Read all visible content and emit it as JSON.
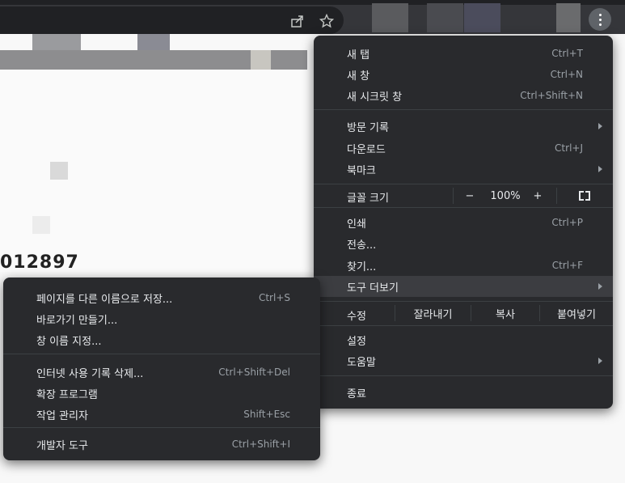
{
  "colors": {
    "menu_bg": "#292a2d",
    "highlight": "#3c3d41",
    "text": "#e8eaed",
    "shortcut": "#9aa0a6"
  },
  "main_menu": {
    "new_tab": {
      "label": "새 탭",
      "shortcut": "Ctrl+T"
    },
    "new_window": {
      "label": "새 창",
      "shortcut": "Ctrl+N"
    },
    "incognito": {
      "label": "새 시크릿 창",
      "shortcut": "Ctrl+Shift+N"
    },
    "history": {
      "label": "방문 기록"
    },
    "downloads": {
      "label": "다운로드",
      "shortcut": "Ctrl+J"
    },
    "bookmarks": {
      "label": "북마크"
    },
    "zoom": {
      "label": "글꼴 크기",
      "minus": "−",
      "value": "100%",
      "plus": "+"
    },
    "print": {
      "label": "인쇄",
      "shortcut": "Ctrl+P"
    },
    "cast": {
      "label": "전송..."
    },
    "find": {
      "label": "찾기...",
      "shortcut": "Ctrl+F"
    },
    "more_tools": {
      "label": "도구 더보기"
    },
    "edit": {
      "label": "수정",
      "cut": "잘라내기",
      "copy": "복사",
      "paste": "붙여넣기"
    },
    "settings": {
      "label": "설정"
    },
    "help": {
      "label": "도움말"
    },
    "exit": {
      "label": "종료"
    }
  },
  "sub_menu": {
    "save_page": {
      "label": "페이지를 다른 이름으로 저장...",
      "shortcut": "Ctrl+S"
    },
    "create_shortcut": {
      "label": "바로가기 만들기..."
    },
    "name_window": {
      "label": "창 이름 지정..."
    },
    "clear_data": {
      "label": "인터넷 사용 기록 삭제...",
      "shortcut": "Ctrl+Shift+Del"
    },
    "extensions": {
      "label": "확장 프로그램"
    },
    "task_manager": {
      "label": "작업 관리자",
      "shortcut": "Shift+Esc"
    },
    "dev_tools": {
      "label": "개발자 도구",
      "shortcut": "Ctrl+Shift+I"
    }
  },
  "page": {
    "partial_text": "012897"
  }
}
